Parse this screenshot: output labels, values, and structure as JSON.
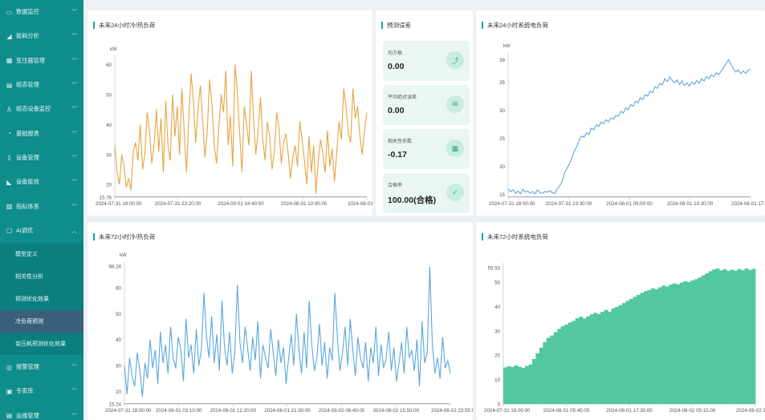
{
  "sidebar": {
    "items": [
      {
        "label": "数据监控",
        "icon": "monitor-icon",
        "glyph": "▭"
      },
      {
        "label": "能耗分析",
        "icon": "analysis-icon",
        "glyph": "◢"
      },
      {
        "label": "变压器管理",
        "icon": "transformer-icon",
        "glyph": "▦"
      },
      {
        "label": "组态管理",
        "icon": "config-icon",
        "glyph": "▤"
      },
      {
        "label": "组态设备监控",
        "icon": "device-monitor-icon",
        "glyph": "♙"
      },
      {
        "label": "基础报表",
        "icon": "report-icon",
        "glyph": "◔"
      },
      {
        "label": "设备管理",
        "icon": "device-icon",
        "glyph": "▯"
      },
      {
        "label": "设备能效",
        "icon": "efficiency-icon",
        "glyph": "◣"
      },
      {
        "label": "指标体系",
        "icon": "index-icon",
        "glyph": "▧"
      },
      {
        "label": "AI调优",
        "icon": "ai-icon",
        "glyph": "▢"
      }
    ],
    "sub_items": [
      {
        "label": "模型定义",
        "active": false
      },
      {
        "label": "相关性分析",
        "active": false
      },
      {
        "label": "预测优化效果",
        "active": false
      },
      {
        "label": "冷负荷预测",
        "active": true
      },
      {
        "label": "变压耗预测优化效果",
        "active": false
      }
    ],
    "bottom_items": [
      {
        "label": "报警管理",
        "icon": "alarm-icon",
        "glyph": "◎"
      },
      {
        "label": "专家库",
        "icon": "expert-icon",
        "glyph": "▣"
      },
      {
        "label": "运维管理",
        "icon": "ops-icon",
        "glyph": "▤"
      }
    ]
  },
  "panels": {
    "p1_title": "未来24小时冷/热负荷",
    "p2_title": "预测误差",
    "p3_title": "未来24小时系统电负荷",
    "p4_title": "未来72小时冷/热负荷",
    "p5_title": "未来72小时系统电负荷"
  },
  "metrics": [
    {
      "label": "均方根",
      "value": "0.00",
      "icon": "chart-up-icon",
      "glyph": "⤴"
    },
    {
      "label": "平均绝对误差",
      "value": "0.00",
      "icon": "message-icon",
      "glyph": "✉"
    },
    {
      "label": "相关性系数",
      "value": "-0.17",
      "icon": "calculator-icon",
      "glyph": "▦"
    },
    {
      "label": "合格率",
      "value": "100.00(合格)",
      "icon": "shield-check-icon",
      "glyph": "✓"
    }
  ],
  "colors": {
    "accent": "#17a2a2",
    "orange": "#e8a440",
    "blue": "#5aa7dd",
    "green": "#52c7a0"
  },
  "chart_data": [
    {
      "id": "c1",
      "type": "line",
      "ylabel": "kW",
      "ylim": [
        15.76,
        61.5
      ],
      "yticks": [
        "60",
        "50",
        "40",
        "30",
        "20",
        "15.76"
      ],
      "yticks_val": [
        60,
        50,
        40,
        30,
        20,
        15.76
      ],
      "xticks": [
        "2024-07-31 18:00:00",
        "2024-07-31 23:20:00",
        "2024-08-01 04:40:00",
        "2024-08-01 10:00:00",
        "2024-08-01 1"
      ],
      "color": "#e8a440",
      "series": [
        {
          "values": [
            33,
            24,
            20,
            30,
            26,
            19,
            22,
            18,
            31,
            34,
            28,
            40,
            25,
            30,
            44,
            38,
            27,
            33,
            45,
            31,
            42,
            24,
            48,
            33,
            28,
            50,
            36,
            46,
            30,
            52,
            38,
            24,
            42,
            57,
            48,
            34,
            45,
            53,
            41,
            29,
            38,
            55,
            47,
            33,
            27,
            39,
            50,
            44,
            58,
            33,
            43,
            26,
            60,
            51,
            37,
            24,
            46,
            40,
            33,
            58,
            42,
            30,
            38,
            49,
            35,
            28,
            41,
            36,
            25,
            31,
            44,
            39,
            27,
            34,
            37,
            30,
            22,
            29,
            33,
            26,
            41,
            35,
            28,
            20,
            36,
            24,
            33,
            17,
            28,
            35,
            30,
            24,
            38,
            26,
            32,
            21,
            31,
            41,
            35,
            52,
            46,
            37,
            34,
            52,
            42,
            46,
            36,
            30,
            38,
            44
          ]
        }
      ]
    },
    {
      "id": "c2",
      "type": "line",
      "ylabel": "kW",
      "ylim": [
        14.5,
        39.5
      ],
      "yticks": [
        "39",
        "35",
        "30",
        "25",
        "20",
        "15"
      ],
      "yticks_val": [
        39,
        35,
        30,
        25,
        20,
        15
      ],
      "xticks": [
        "2024-07-31 18:00:00",
        "2024-07-31 23:30:00",
        "2024-08-01 05:00:00",
        "2024-08-01 10:30:00",
        "2024-08-01 17:55"
      ],
      "color": "#5aa7dd",
      "series": [
        {
          "values": [
            16,
            15.5,
            15.8,
            15.2,
            15.6,
            15.1,
            15.9,
            15.4,
            15.6,
            15.2,
            15.5,
            15.1,
            15.8,
            15.3,
            15.2,
            15.5,
            15.4,
            15.7,
            15.3,
            15.1,
            15.9,
            16.5,
            17.2,
            18.8,
            19.6,
            20.4,
            21.5,
            22.7,
            23.5,
            24.6,
            25.4,
            25.2,
            26.0,
            25.7,
            26.8,
            26.5,
            27.4,
            27.1,
            27.9,
            27.6,
            28.3,
            27.9,
            28.6,
            28.4,
            29.1,
            28.9,
            29.8,
            29.5,
            30.4,
            30.1,
            31.0,
            30.7,
            31.6,
            31.3,
            32.2,
            31.9,
            32.8,
            32.5,
            33.4,
            33.1,
            34.2,
            33.9,
            34.8,
            34.5,
            35.6,
            35.1,
            35.9,
            35.3,
            34.9,
            35.4,
            34.6,
            35.2,
            34.4,
            34.9,
            34.3,
            35.0,
            34.6,
            35.3,
            34.8,
            35.6,
            35.2,
            36.0,
            35.6,
            36.3,
            36.0,
            36.7,
            36.3,
            37.0,
            37.6,
            38.3,
            39.0,
            38.2,
            37.4,
            36.8,
            37.2,
            36.5,
            37.0,
            36.6,
            37.1,
            37.3
          ]
        }
      ]
    },
    {
      "id": "c3",
      "type": "line",
      "ylabel": "kW",
      "ylim": [
        15.24,
        68.28
      ],
      "yticks": [
        "68.28",
        "60",
        "50",
        "40",
        "30",
        "20",
        "15.24"
      ],
      "yticks_val": [
        68.28,
        60,
        50,
        40,
        30,
        20,
        15.24
      ],
      "xticks": [
        "2024-07-31 18:00:00",
        "2024-08-01 03:10:00",
        "2024-08-01 12:20:00",
        "2024-08-01 21:30:00",
        "2024-08-02 06:40:00",
        "2024-08-02 15:50:00",
        "2024-08-02 23:55:00"
      ],
      "color": "#5aa7dd",
      "series": [
        {
          "values": [
            30,
            19,
            33,
            26,
            22,
            35,
            28,
            18,
            31,
            25,
            40,
            29,
            36,
            23,
            43,
            31,
            38,
            27,
            45,
            33,
            29,
            41,
            36,
            24,
            48,
            33,
            38,
            27,
            44,
            30,
            36,
            58,
            41,
            33,
            49,
            31,
            42,
            28,
            55,
            37,
            30,
            43,
            27,
            35,
            61,
            39,
            31,
            45,
            37,
            28,
            41,
            32,
            47,
            25,
            38,
            33,
            29,
            44,
            35,
            26,
            40,
            31,
            37,
            23,
            33,
            42,
            30,
            50,
            36,
            27,
            43,
            29,
            55,
            38,
            28,
            33,
            46,
            30,
            39,
            25,
            37,
            32,
            58,
            41,
            28,
            35,
            45,
            30,
            48,
            36,
            26,
            41,
            33,
            29,
            39,
            24,
            37,
            31,
            45,
            26,
            38,
            29,
            33,
            43,
            28,
            37,
            24,
            31,
            39,
            27,
            45,
            33,
            36,
            28,
            40,
            22,
            47,
            31,
            35,
            68,
            38,
            27,
            33,
            25,
            41,
            29,
            32,
            27
          ]
        }
      ]
    },
    {
      "id": "c4",
      "type": "area",
      "ylim": [
        0,
        55.93
      ],
      "yticks": [
        "55.93",
        "50",
        "40",
        "30",
        "20",
        "10",
        "0"
      ],
      "yticks_val": [
        55.93,
        50,
        40,
        30,
        20,
        10,
        0
      ],
      "xticks": [
        "2024-07-31 18:00:00",
        "2024-08-01 05:45:00",
        "2024-08-01 17:30:00",
        "2024-08-02 05:15:00",
        "2024-08-02 2"
      ],
      "color": "#52c7a0",
      "series": [
        {
          "values": [
            15,
            15.5,
            15.2,
            15.8,
            15.3,
            14.8,
            15.6,
            16.2,
            18.5,
            20.8,
            23.1,
            25.4,
            27.2,
            28.1,
            29.5,
            30.8,
            31.9,
            32.6,
            33.4,
            34.1,
            35.2,
            35.8,
            35.1,
            36.0,
            36.8,
            37.4,
            36.9,
            37.8,
            38.6,
            37.9,
            39.2,
            39.8,
            40.6,
            41.4,
            42.3,
            43.1,
            44.0,
            44.8,
            45.6,
            46.3,
            46.8,
            47.5,
            47.1,
            47.9,
            48.6,
            48.2,
            49.0,
            49.5,
            49.1,
            49.8,
            50.4,
            50.0,
            50.7,
            51.2,
            51.9,
            52.8,
            53.6,
            54.5,
            55.2,
            55.6,
            54.8,
            55.3,
            54.6,
            55.1,
            54.7,
            55.4,
            54.9,
            55.6,
            55.0,
            55.5
          ]
        }
      ]
    }
  ]
}
